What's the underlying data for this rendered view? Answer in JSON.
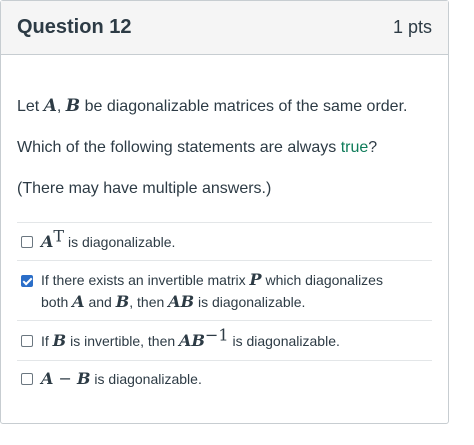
{
  "question": {
    "title": "Question 12",
    "points": "1 pts"
  },
  "stem": {
    "line1_prefix": "Let ",
    "var_a": "A",
    "comma": ", ",
    "var_b": "B",
    "line1_suffix": " be diagonalizable matrices of the same order.",
    "line2_prefix": "Which of the following statements are always ",
    "line2_highlight": "true",
    "line2_suffix": "?",
    "line3": "(There may have multiple answers.)"
  },
  "answers": [
    {
      "checked": false,
      "math_main": "A",
      "math_sup": "T",
      "text": " is diagonalizable."
    },
    {
      "checked": true,
      "t1": "If there exists an invertible matrix ",
      "m1": "P",
      "t2": " which diagonalizes",
      "t3": "both ",
      "m2": "A",
      "t4": " and ",
      "m3": "B",
      "t5": ", then ",
      "m4": "AB",
      "t6": " is diagonalizable."
    },
    {
      "checked": false,
      "t1": "If ",
      "m1": "B",
      "t2": " is invertible, then ",
      "m2": "AB",
      "sup": "−1",
      "t3": " is diagonalizable."
    },
    {
      "checked": false,
      "m1": "A",
      "op": " − ",
      "m2": "B",
      "t1": " is diagonalizable."
    }
  ],
  "colors": {
    "checkbox_checked": "#2b6ec8",
    "true_highlight": "#0f7c5a",
    "header_bg": "#f5f5f5",
    "border": "#c7cdd1"
  }
}
